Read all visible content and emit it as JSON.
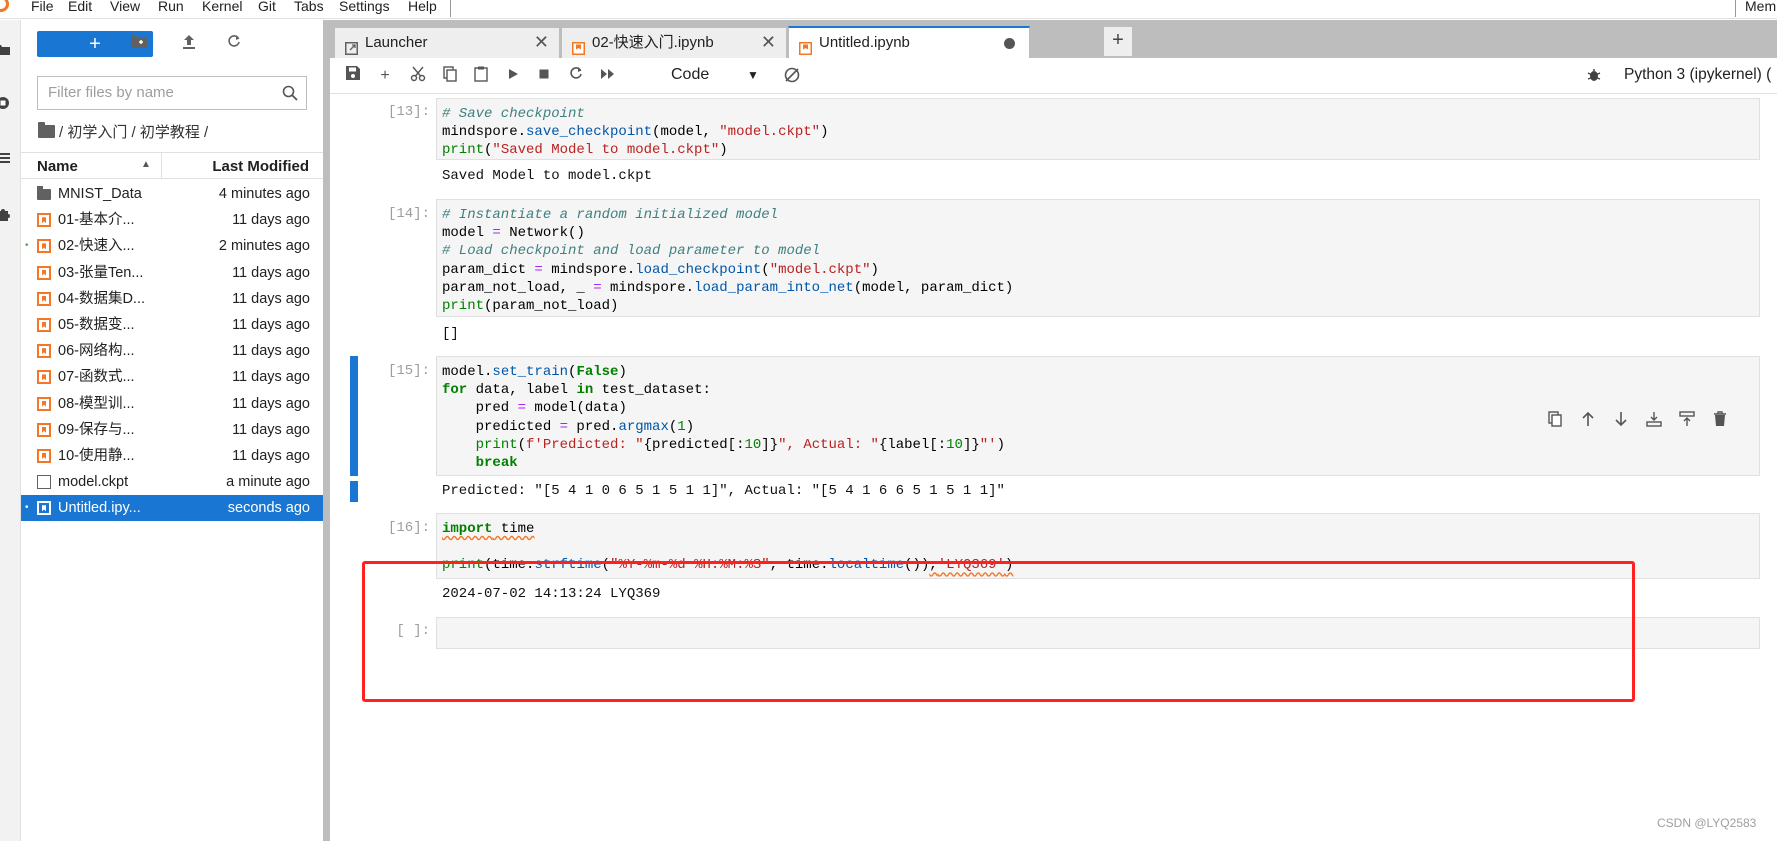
{
  "menubar": {
    "items": [
      "File",
      "Edit",
      "View",
      "Run",
      "Kernel",
      "Git",
      "Tabs",
      "Settings",
      "Help"
    ],
    "memory_label": "Mem"
  },
  "filebrowser": {
    "new_button_label": "+",
    "filter_placeholder": "Filter files by name",
    "breadcrumb": "/ 初学入门 / 初学教程 /",
    "columns": {
      "name": "Name",
      "modified": "Last Modified"
    },
    "files": [
      {
        "name": "MNIST_Data",
        "modified": "4 minutes ago",
        "type": "folder",
        "running": false,
        "selected": false
      },
      {
        "name": "01-基本介...",
        "modified": "11 days ago",
        "type": "notebook",
        "running": false,
        "selected": false
      },
      {
        "name": "02-快速入...",
        "modified": "2 minutes ago",
        "type": "notebook",
        "running": true,
        "selected": false
      },
      {
        "name": "03-张量Ten...",
        "modified": "11 days ago",
        "type": "notebook",
        "running": false,
        "selected": false
      },
      {
        "name": "04-数据集D...",
        "modified": "11 days ago",
        "type": "notebook",
        "running": false,
        "selected": false
      },
      {
        "name": "05-数据变...",
        "modified": "11 days ago",
        "type": "notebook",
        "running": false,
        "selected": false
      },
      {
        "name": "06-网络构...",
        "modified": "11 days ago",
        "type": "notebook",
        "running": false,
        "selected": false
      },
      {
        "name": "07-函数式...",
        "modified": "11 days ago",
        "type": "notebook",
        "running": false,
        "selected": false
      },
      {
        "name": "08-模型训...",
        "modified": "11 days ago",
        "type": "notebook",
        "running": false,
        "selected": false
      },
      {
        "name": "09-保存与...",
        "modified": "11 days ago",
        "type": "notebook",
        "running": false,
        "selected": false
      },
      {
        "name": "10-使用静...",
        "modified": "11 days ago",
        "type": "notebook",
        "running": false,
        "selected": false
      },
      {
        "name": "model.ckpt",
        "modified": "a minute ago",
        "type": "file",
        "running": false,
        "selected": false
      },
      {
        "name": "Untitled.ipy...",
        "modified": "seconds ago",
        "type": "notebook",
        "running": true,
        "selected": true
      }
    ]
  },
  "tabs": [
    {
      "label": "Launcher",
      "icon": "launcher-icon"
    },
    {
      "label": "02-快速入门.ipynb",
      "icon": "notebook-icon"
    },
    {
      "label": "Untitled.ipynb",
      "icon": "notebook-icon",
      "active": true,
      "unsaved": true
    }
  ],
  "toolbar": {
    "cell_type": "Code",
    "kernel": "Python 3 (ipykernel)",
    "kernel_status_suffix": "("
  },
  "cells": {
    "c13": {
      "prompt": "[13]:",
      "output": "Saved Model to model.ckpt"
    },
    "c14": {
      "prompt": "[14]:",
      "output": "[]"
    },
    "c15": {
      "prompt": "[15]:",
      "output": "Predicted: \"[5 4 1 0 6 5 1 5 1 1]\", Actual: \"[5 4 1 6 6 5 1 5 1 1]\""
    },
    "c16": {
      "prompt": "[16]:",
      "output": "2024-07-02 14:13:24 LYQ369"
    },
    "c17": {
      "prompt": "[ ]:"
    }
  },
  "watermark": "CSDN @LYQ2583",
  "colors": {
    "accent": "#1976d2",
    "notebook_orange": "#f37726",
    "highlight_red": "#ff2020"
  }
}
